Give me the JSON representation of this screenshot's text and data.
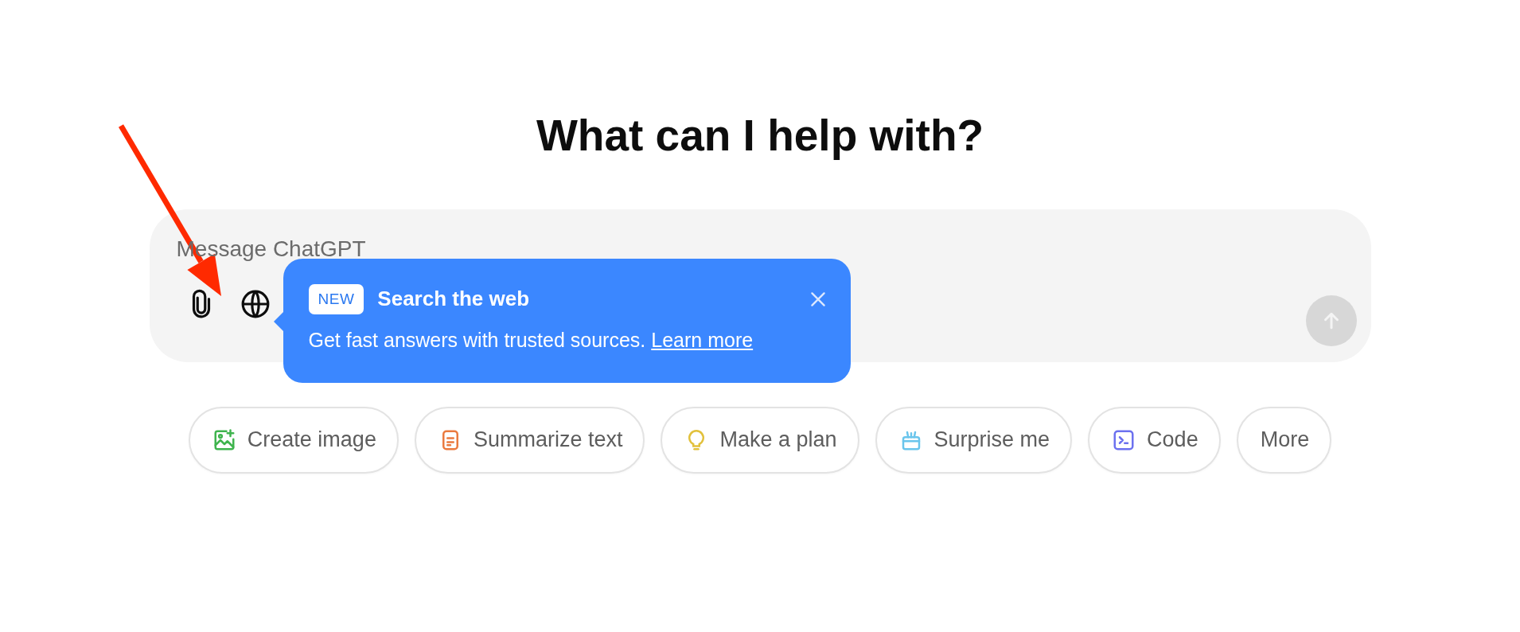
{
  "heading": "What can I help with?",
  "composer": {
    "placeholder": "Message ChatGPT",
    "tools": [
      {
        "kind": "attach"
      },
      {
        "kind": "web"
      }
    ],
    "send_disabled": true
  },
  "popover": {
    "badge": "NEW",
    "title": "Search the web",
    "body": "Get fast answers with trusted sources.",
    "link": "Learn more"
  },
  "chips": [
    {
      "label": "Create image",
      "kind": "image",
      "color": "#3fb44e"
    },
    {
      "label": "Summarize text",
      "kind": "document",
      "color": "#ea7a3f"
    },
    {
      "label": "Make a plan",
      "kind": "bulb",
      "color": "#e2c13c"
    },
    {
      "label": "Surprise me",
      "kind": "gift",
      "color": "#6ac5ec"
    },
    {
      "label": "Code",
      "kind": "terminal",
      "color": "#6c71ef"
    },
    {
      "label": "More",
      "kind": "more"
    }
  ],
  "annotation_arrow": true
}
